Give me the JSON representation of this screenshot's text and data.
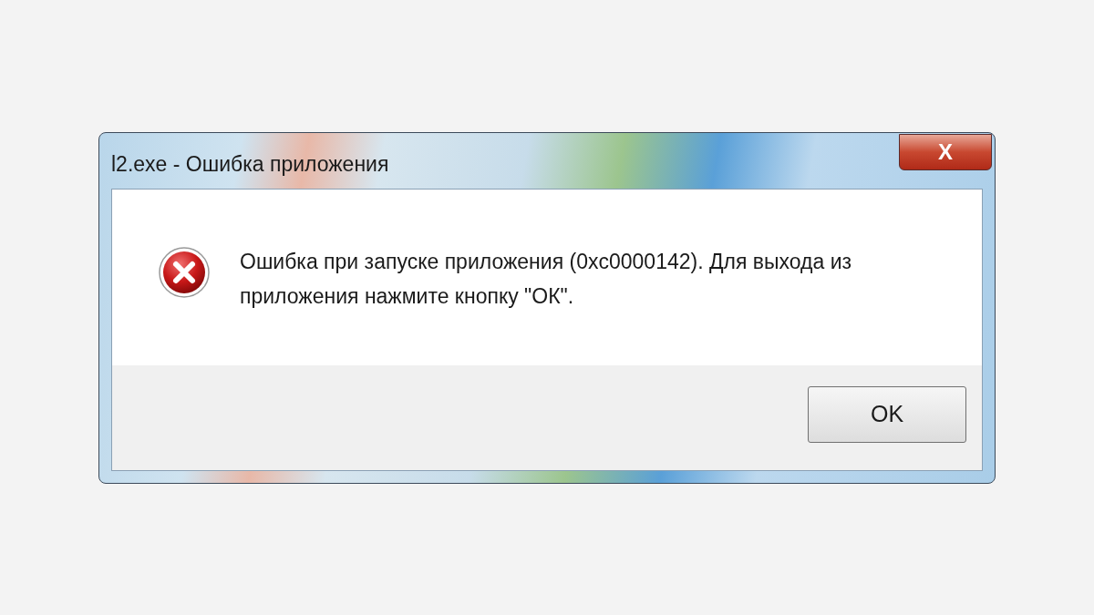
{
  "window": {
    "title": "l2.exe - Ошибка приложения",
    "close_label": "X"
  },
  "message": {
    "kind": "error",
    "text": "Ошибка при запуске приложения (0xc0000142). Для выхода из приложения нажмите кнопку \"ОК\"."
  },
  "buttons": [
    "OK"
  ]
}
